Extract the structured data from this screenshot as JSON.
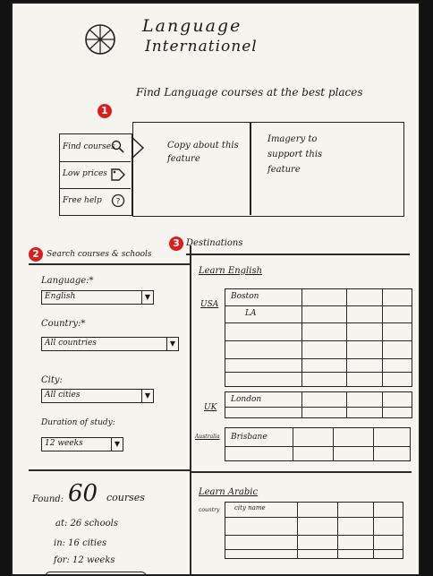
{
  "header": {
    "title_line1": "Language",
    "title_line2": "Internationel",
    "tagline": "Find Language courses at the best places"
  },
  "badges": [
    "1",
    "2",
    "3"
  ],
  "feature_menu": {
    "items": [
      {
        "label": "Find courses",
        "icon": "magnifier-icon"
      },
      {
        "label": "Low prices",
        "icon": "tag-icon"
      },
      {
        "label": "Free help",
        "icon": "question-icon"
      }
    ],
    "panel_text_1": "Copy about this feature",
    "panel_text_2": "Imagery to support this feature"
  },
  "search": {
    "heading": "Search courses & schools",
    "language_label": "Language:*",
    "language_value": "English",
    "country_label": "Country:*",
    "country_value": "All countries",
    "city_label": "City:",
    "city_value": "All cities",
    "duration_label": "Duration of study:",
    "duration_value": "12 weeks",
    "results": {
      "found_prefix": "Found:",
      "found_count": "60",
      "found_suffix": "courses",
      "schools_line": "at: 26 schools",
      "cities_line": "in: 16 cities",
      "weeks_line": "for: 12 weeks"
    }
  },
  "destinations": {
    "heading": "Destinations",
    "learn_english": "Learn English",
    "usa": {
      "country": "USA",
      "cities": [
        "Boston",
        "LA"
      ]
    },
    "uk": {
      "country": "UK",
      "cities": [
        "London"
      ]
    },
    "australia": {
      "country": "Australia",
      "cities": [
        "Brisbane"
      ]
    },
    "learn_arabic": "Learn Arabic",
    "arabic_country_label": "country",
    "arabic_city_placeholder": "city name"
  }
}
